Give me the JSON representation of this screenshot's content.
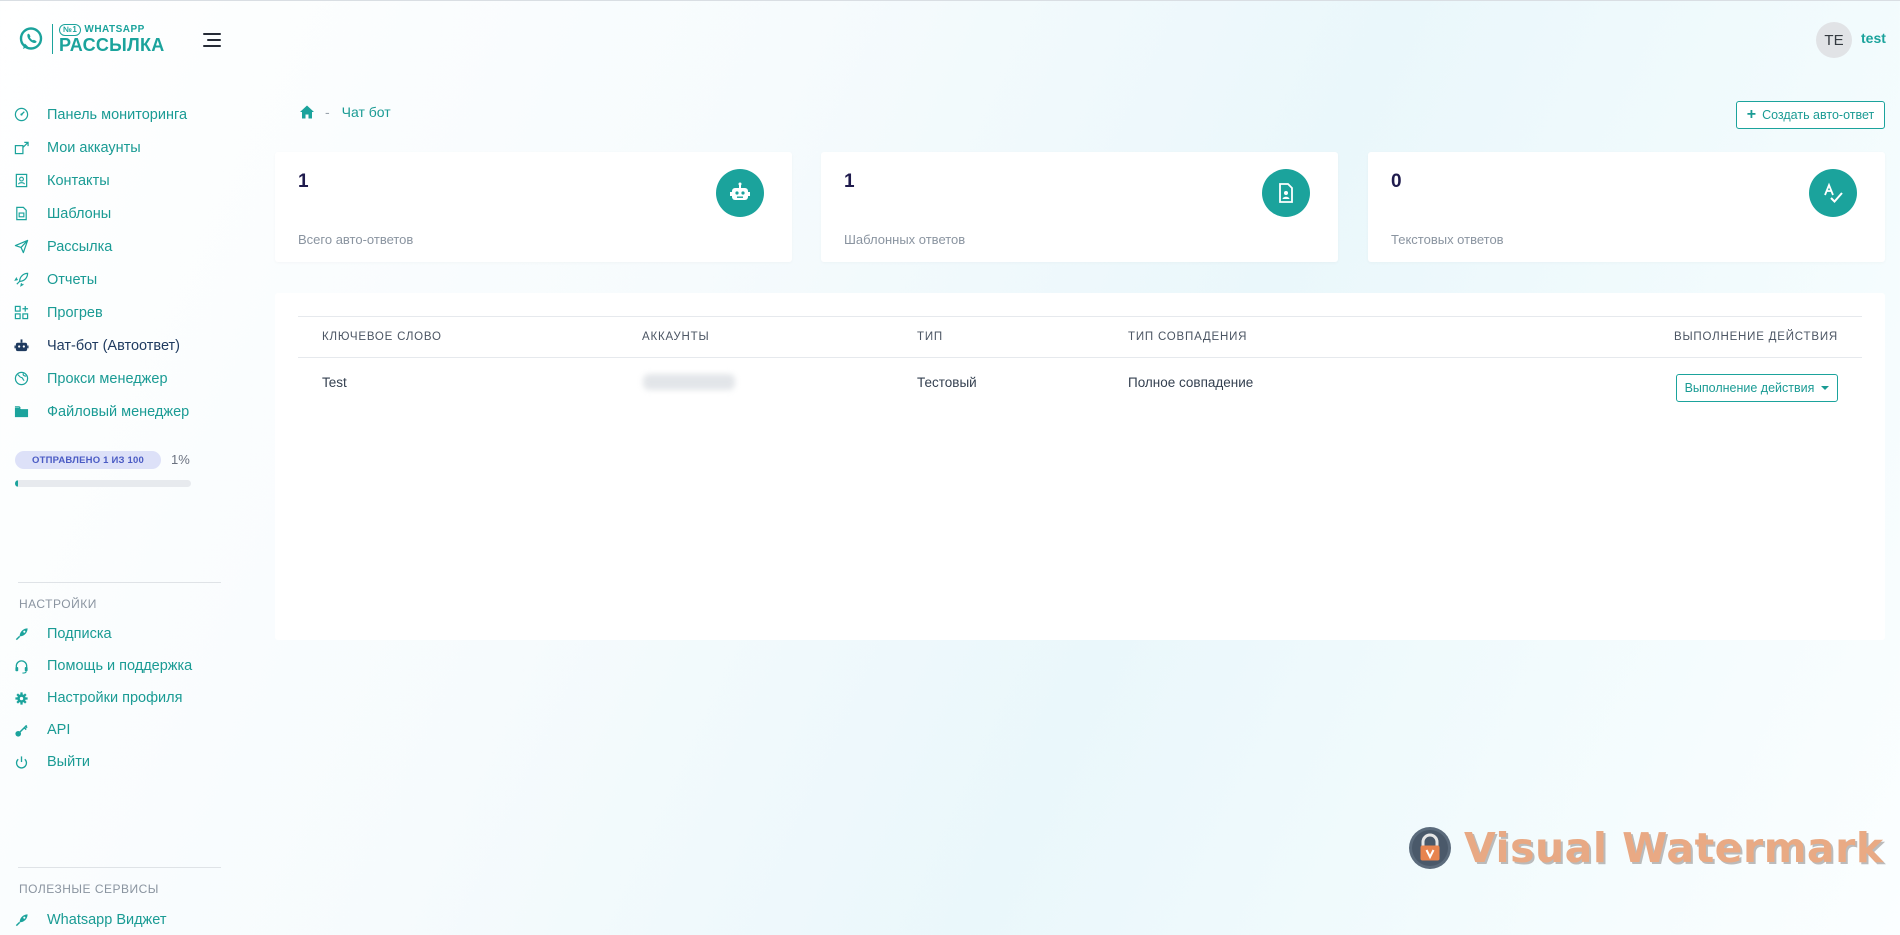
{
  "brand": {
    "logo_top": "WHATSAPP",
    "logo_badge": "№1",
    "logo_bottom": "РАССЫЛКА",
    "accent_color": "#1ba39c"
  },
  "sidebar": {
    "items": [
      {
        "label": "Панель мониторинга",
        "icon": "gauge-icon"
      },
      {
        "label": "Мои аккаунты",
        "icon": "accounts-icon"
      },
      {
        "label": "Контакты",
        "icon": "contacts-icon"
      },
      {
        "label": "Шаблоны",
        "icon": "templates-icon"
      },
      {
        "label": "Рассылка",
        "icon": "send-icon"
      },
      {
        "label": "Отчеты",
        "icon": "rocket-icon"
      },
      {
        "label": "Прогрев",
        "icon": "grid-plus-icon"
      },
      {
        "label": "Чат-бот (Автоответ)",
        "icon": "robot-icon",
        "active": true
      },
      {
        "label": "Прокси менеджер",
        "icon": "globe-icon"
      },
      {
        "label": "Файловый менеджер",
        "icon": "folder-icon"
      }
    ],
    "progress": {
      "badge": "ОТПРАВЛЕНО 1 ИЗ 100",
      "percent_label": "1%",
      "value": 0.01
    },
    "settings_title": "НАСТРОЙКИ",
    "settings_items": [
      {
        "label": "Подписка",
        "icon": "rocket-icon"
      },
      {
        "label": "Помощь и поддержка",
        "icon": "headset-icon"
      },
      {
        "label": "Настройки профиля",
        "icon": "gear-icon"
      },
      {
        "label": "API",
        "icon": "key-icon"
      },
      {
        "label": "Выйти",
        "icon": "power-icon"
      }
    ],
    "services_title": "ПОЛЕЗНЫЕ СЕРВИСЫ",
    "services_items": [
      {
        "label": "Whatsapp Виджет",
        "icon": "rocket-icon"
      }
    ]
  },
  "header": {
    "avatar_initials": "TE",
    "username": "test"
  },
  "breadcrumb": {
    "separator": "-",
    "current": "Чат бот"
  },
  "create_button": {
    "label": "Создать авто-ответ"
  },
  "stats": [
    {
      "value": "1",
      "label": "Всего авто-ответов",
      "icon": "robot-icon"
    },
    {
      "value": "1",
      "label": "Шаблонных ответов",
      "icon": "document-icon"
    },
    {
      "value": "0",
      "label": "Текстовых ответов",
      "icon": "spellcheck-icon"
    }
  ],
  "table": {
    "headers": [
      "КЛЮЧЕВОЕ СЛОВО",
      "АККАУНТЫ",
      "ТИП",
      "ТИП СОВПАДЕНИЯ",
      "ВЫПОЛНЕНИЕ ДЕЙСТВИЯ"
    ],
    "rows": [
      {
        "keyword": "Test",
        "type": "Тестовый",
        "match": "Полное совпадение",
        "action_label": "Выполнение действия"
      }
    ]
  },
  "watermark": {
    "text": "Visual Watermark"
  }
}
